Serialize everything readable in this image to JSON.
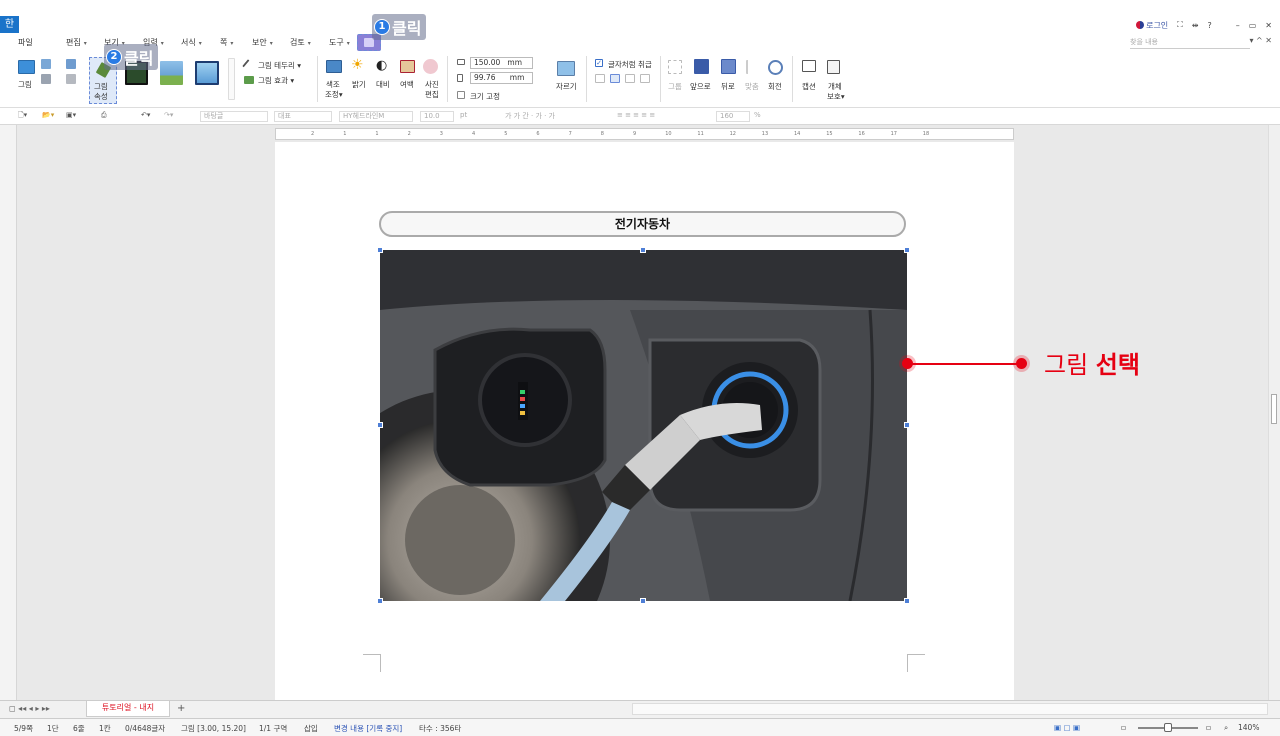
{
  "app": {
    "logo": "한"
  },
  "topright": {
    "login": "로그인",
    "help": "?",
    "minimize": "–",
    "restore": "▭",
    "close": "✕"
  },
  "menu": {
    "items": [
      "파일",
      "편집",
      "보기",
      "입력",
      "서식",
      "쪽",
      "보안",
      "검토",
      "도구"
    ],
    "search_placeholder": "찾을 내용"
  },
  "ribbon": {
    "picture": "그림",
    "picture_props_1": "그림",
    "picture_props_2": "속성",
    "border": "그림 테두리",
    "effect": "그림 효과",
    "color_1": "색조",
    "color_2": "조정",
    "bright": "밝기",
    "contrast": "대비",
    "margin": "여백",
    "photo_1": "사진",
    "photo_2": "편집",
    "width_value": "150.00",
    "height_value": "99.76",
    "unit": "mm",
    "lock_size": "크기 고정",
    "crop": "자르기",
    "treat_as_char": "글자처럼 취급",
    "group": "그룹",
    "front": "앞으로",
    "back": "뒤로",
    "align": "맞춤",
    "rotate": "회전",
    "caption": "캡션",
    "protect_1": "개체",
    "protect_2": "보호"
  },
  "toolbar2": {
    "style": "바탕글",
    "lang": "대표",
    "font": "HY헤드라인M",
    "size": "10.0",
    "size_unit": "pt",
    "line_spacing": "160",
    "pct": "%"
  },
  "ruler": {
    "ticks": [
      "2",
      "1",
      "1",
      "2",
      "3",
      "4",
      "5",
      "6",
      "7",
      "8",
      "9",
      "10",
      "11",
      "12",
      "13",
      "14",
      "15",
      "16",
      "17",
      "18"
    ]
  },
  "document": {
    "caption": "전기자동차"
  },
  "annotation": {
    "normal": "그림 ",
    "bold": "선택"
  },
  "steps": [
    {
      "num": "1",
      "label": "클릭"
    },
    {
      "num": "2",
      "label": "클릭"
    }
  ],
  "tab": {
    "doc_name": "튜토리얼 - 내지",
    "add": "+"
  },
  "status": {
    "page": "5/9쪽",
    "section": "1단",
    "line": "6줄",
    "col": "1칸",
    "chars": "0/4648글자",
    "object": "그림 [3.00, 15.20]",
    "area": "1/1 구역",
    "mode": "삽입",
    "track": "변경 내용 [기록 중지]",
    "keystrokes": "타수 : 356타",
    "zoom": "140%"
  }
}
